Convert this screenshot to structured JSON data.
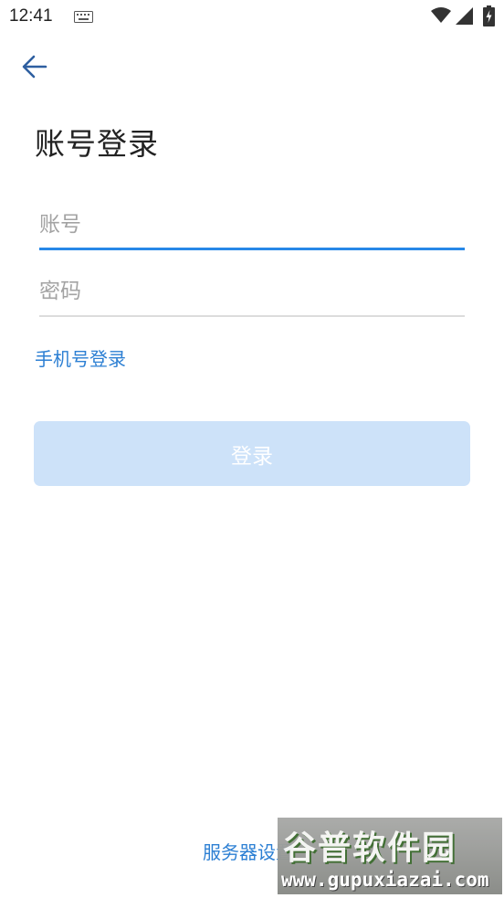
{
  "status_bar": {
    "time": "12:41",
    "icons": [
      "keyboard-icon",
      "wifi-icon",
      "cellular-signal-icon",
      "battery-charging-icon"
    ]
  },
  "nav": {
    "back_icon": "arrow-left-icon"
  },
  "page": {
    "title": "账号登录"
  },
  "form": {
    "account": {
      "placeholder": "账号",
      "value": ""
    },
    "password": {
      "placeholder": "密码",
      "value": ""
    },
    "phone_login_label": "手机号登录",
    "submit_label": "登录"
  },
  "footer": {
    "server_settings_label": "服务器设置"
  },
  "watermark": {
    "title": "谷普软件园",
    "url": "www.gupuxiazai.com"
  },
  "colors": {
    "accent": "#2788e8",
    "link": "#2c7fd3",
    "button_disabled_bg": "#cde2f9",
    "text_primary": "#222222",
    "placeholder": "#a3a3a3",
    "divider": "#dcdcdc"
  }
}
